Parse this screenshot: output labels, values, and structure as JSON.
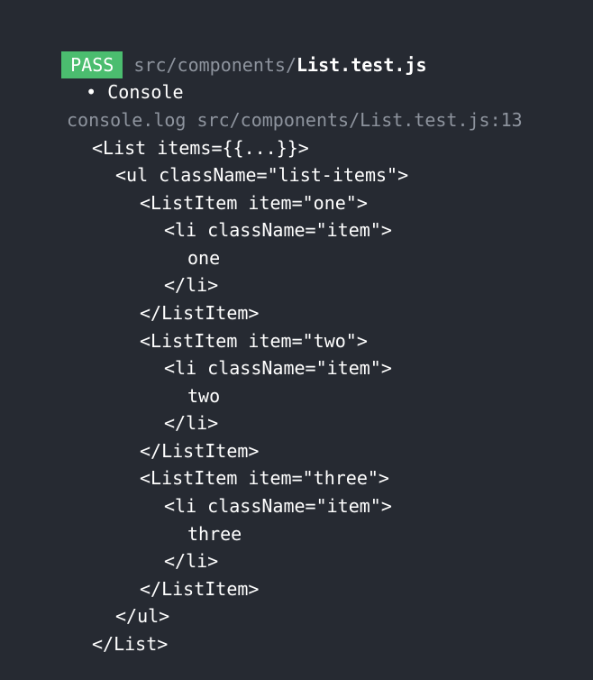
{
  "header": {
    "badge": "PASS",
    "path_dir": "src/components/",
    "path_file": "List.test.js"
  },
  "console_section": {
    "bullet": "•",
    "title": "Console"
  },
  "log_origin": "console.log src/components/List.test.js:13",
  "output_lines": [
    "<List items={{...}}>",
    "<ul className=\"list-items\">",
    "<ListItem item=\"one\">",
    "<li className=\"item\">",
    "one",
    "</li>",
    "</ListItem>",
    "<ListItem item=\"two\">",
    "<li className=\"item\">",
    "two",
    "</li>",
    "</ListItem>",
    "<ListItem item=\"three\">",
    "<li className=\"item\">",
    "three",
    "</li>",
    "</ListItem>",
    "</ul>",
    "</List>"
  ],
  "colors": {
    "background": "#262a32",
    "pass_badge": "#4bbd6f",
    "muted_text": "#8e949e",
    "text": "#ffffff"
  }
}
